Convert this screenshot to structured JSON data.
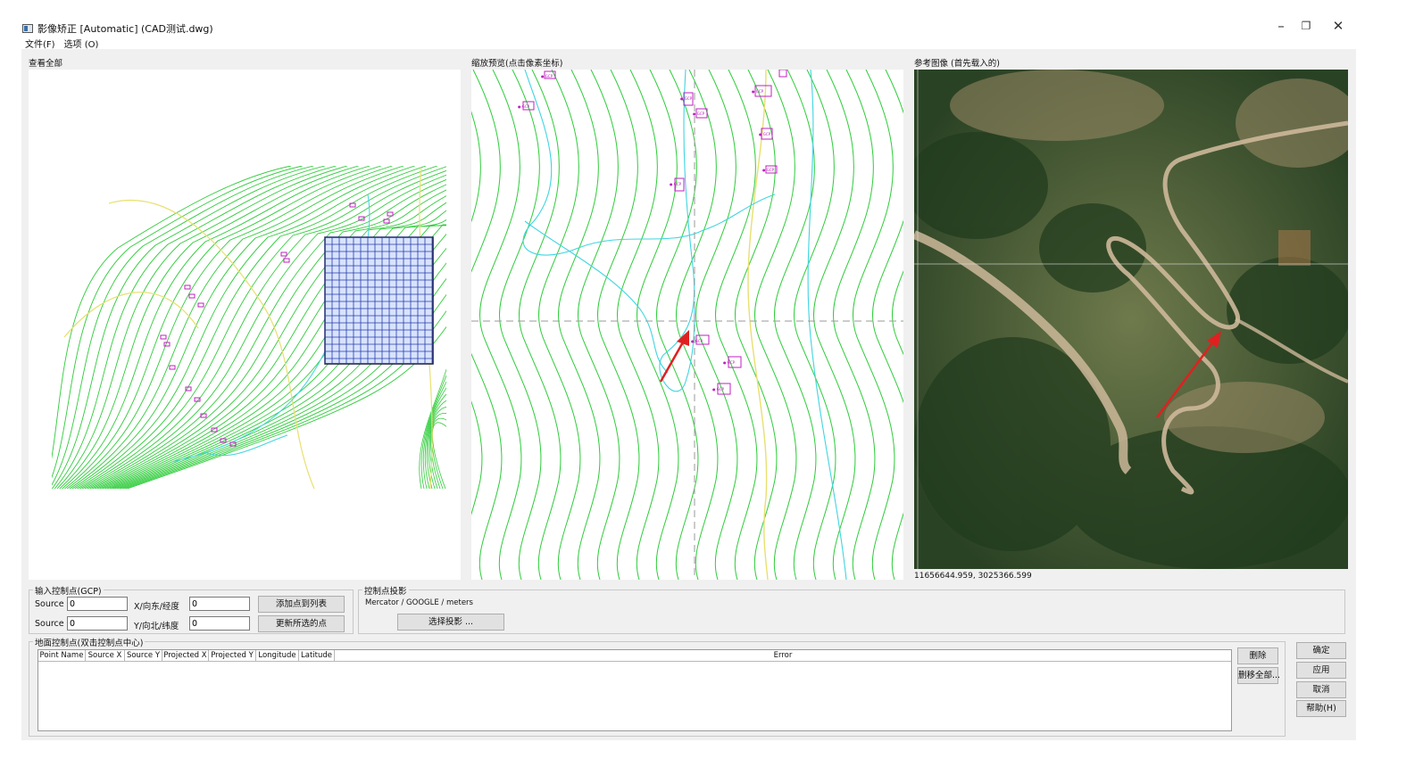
{
  "window": {
    "title": "影像矫正 [Automatic] (CAD测试.dwg)",
    "controls": {
      "minimize": "–",
      "restore": "❐",
      "close": "✕"
    }
  },
  "menu": [
    "文件(F)",
    "选项 (O)"
  ],
  "panels": {
    "overview_title": "查看全部",
    "zoom_title": "缩放预览(点击像素坐标)",
    "reference_title": "参考图像 (首先载入的)",
    "reference_coord": "11656644.959, 3025366.599"
  },
  "gcp_input": {
    "group_label": "输入控制点(GCP)",
    "source_label_1": "Source",
    "source_value_1": "0",
    "x_label": "X/向东/经度",
    "x_value": "0",
    "add_button": "添加点到列表",
    "source_label_2": "Source",
    "source_value_2": "0",
    "y_label": "Y/向北/纬度",
    "y_value": "0",
    "update_button": "更新所选的点"
  },
  "projection": {
    "group_label": "控制点投影",
    "value": "Mercator / GOOGLE / meters",
    "select_button": "选择投影 ..."
  },
  "gcp_list": {
    "group_label": "地面控制点(双击控制点中心)",
    "columns": [
      "Point Name",
      "Source X",
      "Source Y",
      "Projected X",
      "Projected Y",
      "Longitude",
      "Latitude",
      "Error"
    ],
    "rows": [],
    "delete_button": "删除",
    "remove_all_button": "删移全部..."
  },
  "dialog_buttons": {
    "ok": "确定",
    "apply": "应用",
    "cancel": "取消",
    "help": "帮助(H)"
  },
  "colors": {
    "contour_green": "#2ecc3a",
    "contour_yellow": "#e8e070",
    "stream_cyan": "#3fd5e0",
    "marker_magenta": "#c020c0",
    "grid_blue": "#3040c8",
    "arrow_red": "#e02020"
  }
}
